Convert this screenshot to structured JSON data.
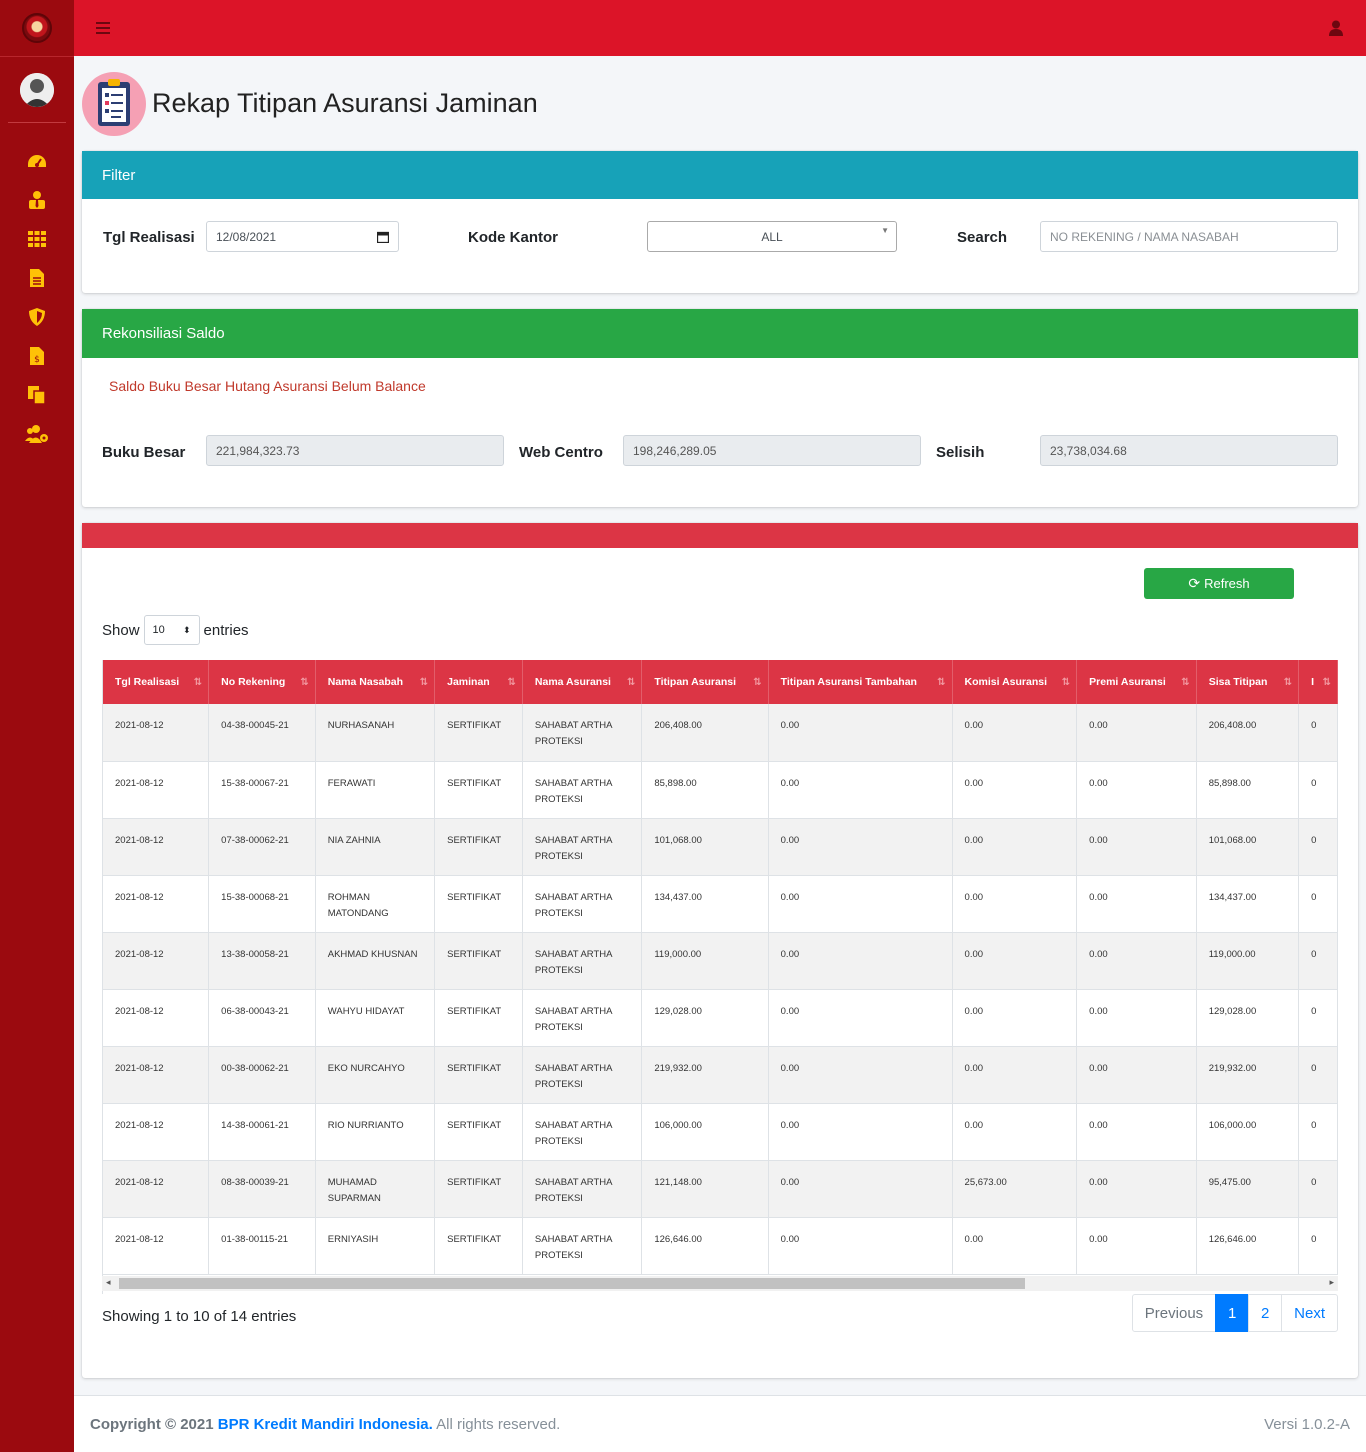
{
  "page": {
    "title": "Rekap Titipan Asuransi Jaminan"
  },
  "filter": {
    "header": "Filter",
    "tgl_label": "Tgl Realisasi",
    "tgl_value": "12/08/2021",
    "kantor_label": "Kode Kantor",
    "kantor_value": "ALL",
    "search_label": "Search",
    "search_placeholder": "NO REKENING / NAMA NASABAH"
  },
  "recon": {
    "header": "Rekonsiliasi Saldo",
    "warning": "Saldo Buku Besar Hutang Asuransi Belum Balance",
    "buku_besar_label": "Buku Besar",
    "buku_besar_value": "221,984,323.73",
    "web_centro_label": "Web Centro",
    "web_centro_value": "198,246,289.05",
    "selisih_label": "Selisih",
    "selisih_value": "23,738,034.68"
  },
  "table": {
    "refresh_label": "Refresh",
    "show_label": "Show",
    "entries_value": "10",
    "entries_label": "entries",
    "columns": [
      "Tgl Realisasi",
      "No Rekening",
      "Nama Nasabah",
      "Jaminan",
      "Nama Asuransi",
      "Titipan Asuransi",
      "Titipan Asuransi Tambahan",
      "Komisi Asuransi",
      "Premi Asuransi",
      "Sisa Titipan",
      "I"
    ],
    "rows": [
      [
        "2021-08-12",
        "04-38-00045-21",
        "NURHASANAH",
        "SERTIFIKAT",
        "SAHABAT ARTHA PROTEKSI",
        "206,408.00",
        "0.00",
        "0.00",
        "0.00",
        "206,408.00",
        "0"
      ],
      [
        "2021-08-12",
        "15-38-00067-21",
        "FERAWATI",
        "SERTIFIKAT",
        "SAHABAT ARTHA PROTEKSI",
        "85,898.00",
        "0.00",
        "0.00",
        "0.00",
        "85,898.00",
        "0"
      ],
      [
        "2021-08-12",
        "07-38-00062-21",
        "NIA ZAHNIA",
        "SERTIFIKAT",
        "SAHABAT ARTHA PROTEKSI",
        "101,068.00",
        "0.00",
        "0.00",
        "0.00",
        "101,068.00",
        "0"
      ],
      [
        "2021-08-12",
        "15-38-00068-21",
        "ROHMAN MATONDANG",
        "SERTIFIKAT",
        "SAHABAT ARTHA PROTEKSI",
        "134,437.00",
        "0.00",
        "0.00",
        "0.00",
        "134,437.00",
        "0"
      ],
      [
        "2021-08-12",
        "13-38-00058-21",
        "AKHMAD KHUSNAN",
        "SERTIFIKAT",
        "SAHABAT ARTHA PROTEKSI",
        "119,000.00",
        "0.00",
        "0.00",
        "0.00",
        "119,000.00",
        "0"
      ],
      [
        "2021-08-12",
        "06-38-00043-21",
        "WAHYU HIDAYAT",
        "SERTIFIKAT",
        "SAHABAT ARTHA PROTEKSI",
        "129,028.00",
        "0.00",
        "0.00",
        "0.00",
        "129,028.00",
        "0"
      ],
      [
        "2021-08-12",
        "00-38-00062-21",
        "EKO NURCAHYO",
        "SERTIFIKAT",
        "SAHABAT ARTHA PROTEKSI",
        "219,932.00",
        "0.00",
        "0.00",
        "0.00",
        "219,932.00",
        "0"
      ],
      [
        "2021-08-12",
        "14-38-00061-21",
        "RIO NURRIANTO",
        "SERTIFIKAT",
        "SAHABAT ARTHA PROTEKSI",
        "106,000.00",
        "0.00",
        "0.00",
        "0.00",
        "106,000.00",
        "0"
      ],
      [
        "2021-08-12",
        "08-38-00039-21",
        "MUHAMAD SUPARMAN",
        "SERTIFIKAT",
        "SAHABAT ARTHA PROTEKSI",
        "121,148.00",
        "0.00",
        "25,673.00",
        "0.00",
        "95,475.00",
        "0"
      ],
      [
        "2021-08-12",
        "01-38-00115-21",
        "ERNIYASIH",
        "SERTIFIKAT",
        "SAHABAT ARTHA PROTEKSI",
        "126,646.00",
        "0.00",
        "0.00",
        "0.00",
        "126,646.00",
        "0"
      ]
    ],
    "info": "Showing 1 to 10 of 14 entries",
    "pager": {
      "previous": "Previous",
      "pages": [
        "1",
        "2"
      ],
      "next": "Next"
    }
  },
  "footer": {
    "copyright": "Copyright © 2021",
    "company": "BPR Kredit Mandiri Indonesia.",
    "rights": "All rights reserved.",
    "version": "Versi 1.0.2-A"
  },
  "icons": {
    "sidebar": [
      "dashboard-icon",
      "user-tie-icon",
      "grid-icon",
      "file-alt-icon",
      "shield-icon",
      "file-invoice-dollar-icon",
      "copy-icon",
      "users-cog-icon"
    ],
    "accent": "#ffc107",
    "brand": "#dc1428"
  }
}
